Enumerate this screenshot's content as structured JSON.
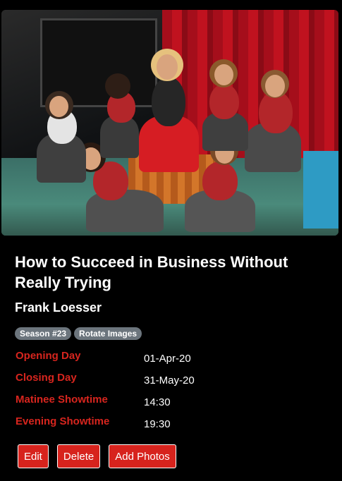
{
  "show": {
    "title": "How to Succeed in Business Without Really Trying",
    "author": "Frank Loesser"
  },
  "badges": {
    "season": "Season #23",
    "rotate": "Rotate Images"
  },
  "details": [
    {
      "label": "Opening Day",
      "value": "01-Apr-20"
    },
    {
      "label": "Closing Day",
      "value": "31-May-20"
    },
    {
      "label": "Matinee Showtime",
      "value": "14:30"
    },
    {
      "label": "Evening Showtime",
      "value": "19:30"
    }
  ],
  "actions": {
    "edit": "Edit",
    "delete": "Delete",
    "add_photos": "Add Photos"
  },
  "colors": {
    "accent": "#d7231d",
    "badge": "#6c757d",
    "background": "#000000"
  }
}
